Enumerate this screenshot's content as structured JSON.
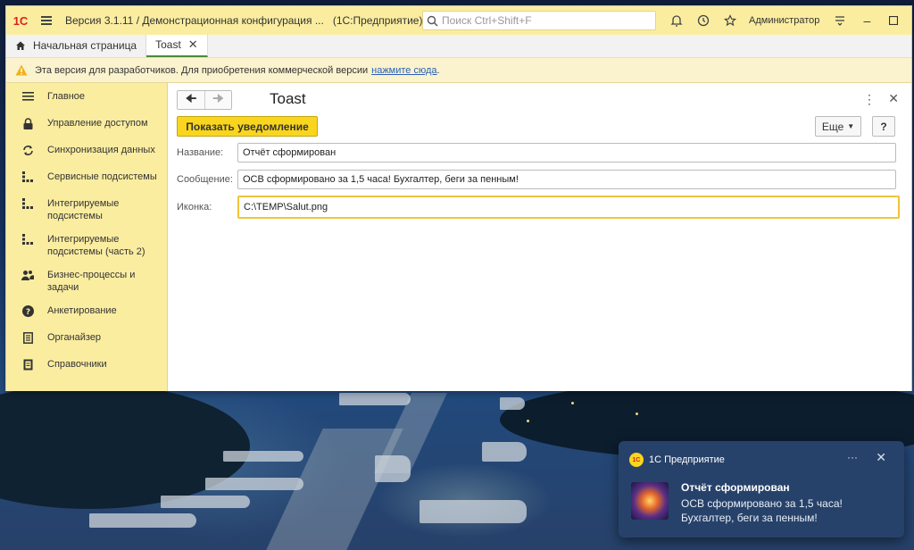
{
  "window": {
    "logo": "1С",
    "title": "Версия 3.1.11 / Демонстрационная конфигурация ...",
    "app_name": "(1С:Предприятие)",
    "search_placeholder": "Поиск Ctrl+Shift+F",
    "user": "Администратор"
  },
  "tabs": [
    {
      "label": "Начальная страница",
      "icon": "home-icon"
    },
    {
      "label": "Toast",
      "closable": true,
      "active": true
    }
  ],
  "notice": {
    "text": "Эта версия для разработчиков. Для приобретения коммерческой версии",
    "link": "нажмите сюда",
    "suffix": "."
  },
  "sidebar": {
    "items": [
      {
        "label": "Главное",
        "icon": "list-icon"
      },
      {
        "label": "Управление доступом",
        "icon": "lock-icon"
      },
      {
        "label": "Синхронизация данных",
        "icon": "sync-icon"
      },
      {
        "label": "Сервисные подсистемы",
        "icon": "grid-icon"
      },
      {
        "label": "Интегрируемые подсистемы",
        "icon": "grid-icon"
      },
      {
        "label": "Интегрируемые подсистемы (часть 2)",
        "icon": "grid-icon"
      },
      {
        "label": "Бизнес-процессы и задачи",
        "icon": "users-icon"
      },
      {
        "label": "Анкетирование",
        "icon": "question-icon"
      },
      {
        "label": "Органайзер",
        "icon": "notebook-icon"
      },
      {
        "label": "Справочники",
        "icon": "book-icon"
      }
    ]
  },
  "form": {
    "title": "Toast",
    "show_button": "Показать уведомление",
    "more_button": "Еще",
    "help_button": "?",
    "fields": [
      {
        "label": "Название:",
        "value": "Отчёт сформирован"
      },
      {
        "label": "Сообщение:",
        "value": "ОСВ сформировано за 1,5 часа! Бухгалтер, беги за пенным!"
      },
      {
        "label": "Иконка:",
        "value": "C:\\TEMP\\Salut.png",
        "focused": true
      }
    ]
  },
  "toast": {
    "app": "1С Предприятие",
    "title": "Отчёт сформирован",
    "message": "ОСВ сформировано за 1,5 часа! Бухгалтер, беги за пенным!"
  },
  "colors": {
    "accent_yellow": "#f9d61d",
    "sidebar_bg": "#fbeda0",
    "toast_bg": "#27426a",
    "logo_red": "#d8231c"
  }
}
